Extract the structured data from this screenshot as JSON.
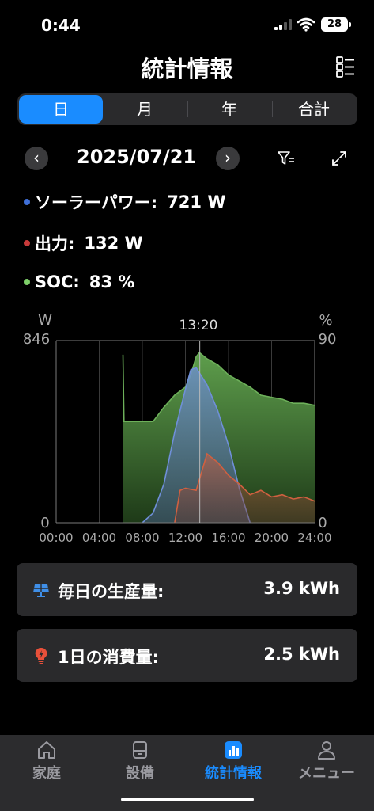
{
  "status": {
    "time": "0:44",
    "battery": "28"
  },
  "header": {
    "title": "統計情報"
  },
  "segments": [
    "日",
    "月",
    "年",
    "合計"
  ],
  "date": {
    "value": "2025/07/21",
    "prev": "‹",
    "next": "›"
  },
  "legend": [
    {
      "label": "ソーラーパワー:",
      "value": "721 W",
      "color": "#3f6fd8"
    },
    {
      "label": "出力:",
      "value": "132 W",
      "color": "#c83a3a"
    },
    {
      "label": "SOC:",
      "value": "83 %",
      "color": "#7fd06a"
    }
  ],
  "chart_data": {
    "type": "area",
    "left_axis": {
      "unit": "W",
      "max": "846",
      "min": "0"
    },
    "right_axis": {
      "unit": "%",
      "max": "90",
      "min": "0"
    },
    "cursor_time": "13:20",
    "x_ticks": [
      "00:00",
      "04:00",
      "08:00",
      "12:00",
      "16:00",
      "20:00",
      "24:00"
    ],
    "series": [
      {
        "name": "SOC",
        "unit": "%",
        "color": "#6db05a",
        "x": [
          6.2,
          6.3,
          6.5,
          7,
          8,
          9,
          10,
          11,
          12,
          12.5,
          13,
          13.3,
          14,
          15,
          16,
          17,
          18,
          19,
          20,
          21,
          22,
          23,
          24
        ],
        "y": [
          83,
          50,
          50,
          50,
          50,
          50,
          57,
          63,
          67,
          73,
          82,
          84,
          81,
          78,
          73,
          70,
          67,
          63,
          62,
          61,
          59,
          59,
          58
        ]
      },
      {
        "name": "ソーラーパワー",
        "unit": "W",
        "color": "#6f8fd8",
        "x": [
          8,
          9,
          10,
          11,
          12,
          12.5,
          13,
          14,
          15,
          16,
          17,
          18
        ],
        "y": [
          0,
          45,
          180,
          420,
          620,
          710,
          720,
          640,
          520,
          360,
          160,
          0
        ]
      },
      {
        "name": "出力",
        "unit": "W",
        "color": "#d06040",
        "x": [
          11,
          11.5,
          12,
          13,
          14,
          15,
          16,
          17,
          18,
          19,
          20,
          21,
          22,
          23,
          24
        ],
        "y": [
          0,
          150,
          160,
          150,
          320,
          280,
          220,
          180,
          130,
          150,
          120,
          130,
          110,
          120,
          100
        ]
      }
    ]
  },
  "cards": [
    {
      "label": "毎日の生産量:",
      "value": "3.9 kWh",
      "icon": "solar-panel-icon"
    },
    {
      "label": "1日の消費量:",
      "value": "2.5 kWh",
      "icon": "bulb-icon"
    }
  ],
  "tabs": [
    {
      "label": "家庭",
      "icon": "home-icon"
    },
    {
      "label": "設備",
      "icon": "device-icon"
    },
    {
      "label": "統計情報",
      "icon": "chart-icon"
    },
    {
      "label": "メニュー",
      "icon": "person-icon"
    }
  ]
}
